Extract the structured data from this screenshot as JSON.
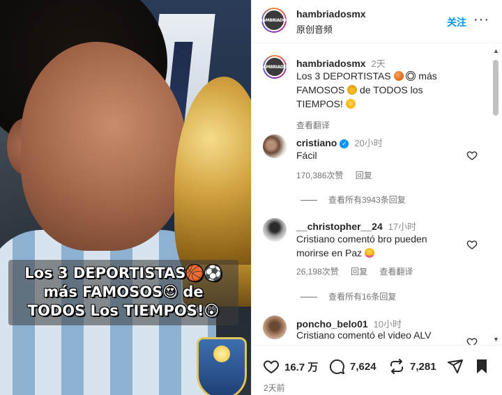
{
  "media": {
    "caption_lines": [
      "Los 3 DEPORTISTAS🏀⚽",
      "más FAMOSOS😍 de",
      "TODOS Los TIEMPOS!😲"
    ]
  },
  "header": {
    "username": "hambriadosmx",
    "subtitle": "原创音频",
    "follow_label": "关注",
    "more_label": "···",
    "avatar_text": "HAMBRIADOS"
  },
  "post": {
    "username": "hambriadosmx",
    "time": "2天",
    "caption_a": "Los 3 DEPORTISTAS",
    "caption_b": " más",
    "caption_c": "FAMOSOS",
    "caption_d": " de TODOS los",
    "caption_e": "TIEMPOS!",
    "translate": "查看翻译"
  },
  "comments": [
    {
      "username": "cristiano",
      "verified": true,
      "time": "20小时",
      "text": "Fácil",
      "likes": "170,386次赞",
      "reply": "回复",
      "view_replies": "查看所有3943条回复"
    },
    {
      "username": "__christopher__24",
      "time": "17小时",
      "text": "Cristiano comentó bro pueden morirse en Paz",
      "likes": "26,198次赞",
      "reply": "回复",
      "translate": "查看翻译",
      "view_replies": "查看所有16条回复"
    },
    {
      "username": "poncho_belo01",
      "time": "10小时",
      "text": "Cristiano comentó el video ALV"
    }
  ],
  "actions": {
    "likes": "16.7 万",
    "comments": "7,624",
    "shares": "7,281",
    "date": "2天前"
  },
  "colors": {
    "accent": "#0095f6",
    "muted": "#737373",
    "text": "#262626"
  }
}
